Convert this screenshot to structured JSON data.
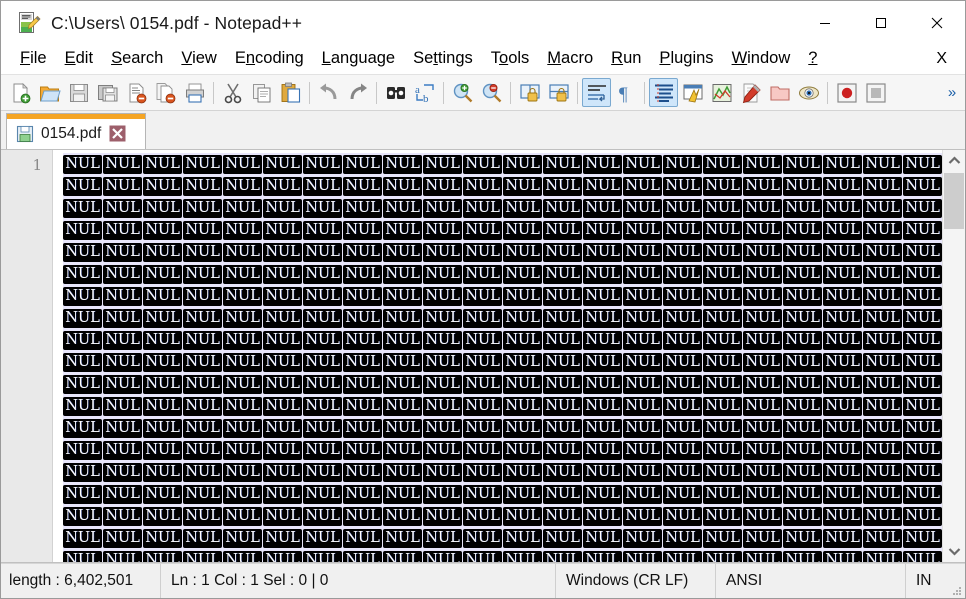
{
  "window": {
    "title": "C:\\Users\\ 0154.pdf - Notepad++",
    "icon": "notepadpp-icon",
    "controls": {
      "minimize": "minimize-icon",
      "maximize": "maximize-icon",
      "close": "close-icon"
    }
  },
  "menubar": {
    "items": [
      {
        "label": "File",
        "accel": "F"
      },
      {
        "label": "Edit",
        "accel": "E"
      },
      {
        "label": "Search",
        "accel": "S"
      },
      {
        "label": "View",
        "accel": "V"
      },
      {
        "label": "Encoding",
        "accel": "n"
      },
      {
        "label": "Language",
        "accel": "L"
      },
      {
        "label": "Settings",
        "accel": "t"
      },
      {
        "label": "Tools",
        "accel": "o"
      },
      {
        "label": "Macro",
        "accel": "M"
      },
      {
        "label": "Run",
        "accel": "R"
      },
      {
        "label": "Plugins",
        "accel": "P"
      },
      {
        "label": "Window",
        "accel": "W"
      },
      {
        "label": "?",
        "accel": "?"
      }
    ],
    "close_doc_label": "X"
  },
  "toolbar": {
    "groups": [
      [
        "new-file-icon",
        "open-file-icon",
        "save-icon",
        "save-all-icon",
        "close-file-icon",
        "close-all-files-icon",
        "print-icon"
      ],
      [
        "cut-icon",
        "copy-icon",
        "paste-icon"
      ],
      [
        "undo-icon",
        "redo-icon"
      ],
      [
        "find-icon",
        "replace-icon"
      ],
      [
        "zoom-in-icon",
        "zoom-out-icon"
      ],
      [
        "sync-vertical-scroll-icon",
        "sync-horizontal-scroll-icon"
      ],
      [
        "word-wrap-icon",
        "show-all-characters-icon"
      ],
      [
        "indent-guide-icon",
        "user-defined-dialog-icon",
        "document-map-icon",
        "function-list-icon",
        "folder-as-workspace-icon",
        "monitoring-icon"
      ],
      [
        "start-record-macro-icon",
        "stop-record-macro-icon"
      ]
    ],
    "active_buttons": [
      "word-wrap-icon",
      "indent-guide-icon"
    ],
    "overflow_label": "»"
  },
  "tabs": [
    {
      "label": "0154.pdf",
      "icon": "saved-file-icon",
      "close_icon": "tab-close-icon",
      "active": true
    }
  ],
  "editor": {
    "line_numbers": [
      "1"
    ],
    "control_char_label": "NUL",
    "columns_per_row": 22,
    "visible_rows": 19,
    "colors": {
      "selection_background": "#e8e6fb",
      "control_char_background": "#000000",
      "control_char_text": "#ffffff",
      "gutter_background": "#e9e9e9",
      "tab_accent": "#f5a524"
    }
  },
  "scrollbar": {
    "up_arrow": "chevron-up-icon",
    "down_arrow": "chevron-down-icon",
    "thumb": "vertical-scroll-thumb"
  },
  "statusbar": {
    "length": "length : 6,402,501",
    "position": "Ln : 1    Col : 1    Sel : 0 | 0",
    "eol": "Windows (CR LF)",
    "encoding": "ANSI",
    "insert_mode": "IN"
  }
}
